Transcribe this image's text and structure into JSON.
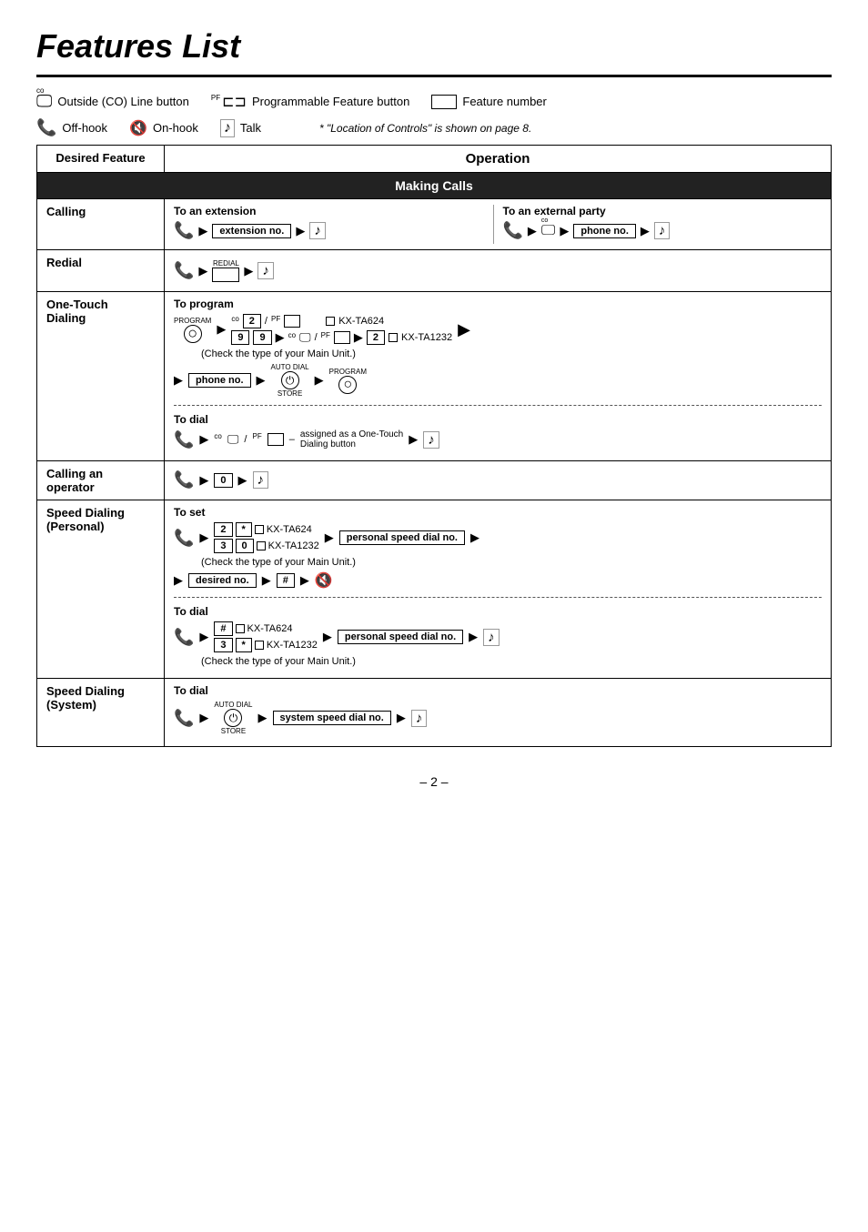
{
  "title": "Features List",
  "legend": {
    "co_line": "Outside (CO) Line button",
    "pf": "Programmable Feature button",
    "feature_number": "Feature number",
    "offhook": "Off-hook",
    "onhook": "On-hook",
    "talk": "Talk",
    "note": "* \"Location of Controls\" is shown on page 8."
  },
  "table": {
    "col1_header": "Desired Feature",
    "col2_header": "Operation",
    "section_making_calls": "Making Calls",
    "rows": [
      {
        "feature": "Calling",
        "ops": "calling"
      },
      {
        "feature": "Redial",
        "ops": "redial"
      },
      {
        "feature": "One-Touch\nDialing",
        "ops": "one_touch"
      },
      {
        "feature": "Calling an\noperator",
        "ops": "calling_operator"
      },
      {
        "feature": "Speed Dialing\n(Personal)",
        "ops": "speed_personal"
      },
      {
        "feature": "Speed Dialing\n(System)",
        "ops": "speed_system"
      }
    ]
  },
  "labels": {
    "to_extension": "To an extension",
    "to_external": "To an external party",
    "extension_no": "extension no.",
    "phone_no": "phone no.",
    "to_program": "To program",
    "to_dial": "To dial",
    "to_set": "To set",
    "kx_ta624": "KX-TA624",
    "kx_ta1232": "KX-TA1232",
    "check_main_unit": "(Check the type of your Main Unit.)",
    "assigned_one_touch": "assigned as a One-Touch",
    "dialing_button": "Dialing button",
    "personal_speed_no": "personal speed dial no.",
    "desired_no": "desired no.",
    "system_speed_no": "system speed dial no."
  },
  "page_number": "– 2 –"
}
